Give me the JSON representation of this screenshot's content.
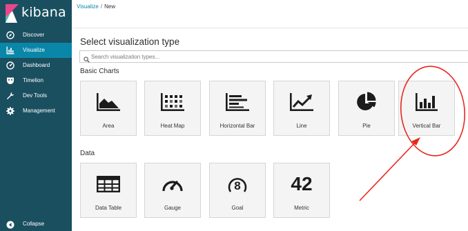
{
  "brand": {
    "name": "kibana"
  },
  "sidebar": {
    "items": [
      {
        "label": "Discover",
        "icon": "compass-icon"
      },
      {
        "label": "Visualize",
        "icon": "bar-chart-icon",
        "active": true
      },
      {
        "label": "Dashboard",
        "icon": "dashboard-gauge-icon"
      },
      {
        "label": "Timelion",
        "icon": "timelion-mask-icon"
      },
      {
        "label": "Dev Tools",
        "icon": "wrench-icon"
      },
      {
        "label": "Management",
        "icon": "gear-icon"
      }
    ],
    "collapse_label": "Collapse"
  },
  "breadcrumb": {
    "link": "Visualize",
    "separator": "/",
    "current": "New"
  },
  "page": {
    "title": "Select visualization type"
  },
  "search": {
    "placeholder": "Search visualization types..."
  },
  "sections": [
    {
      "title": "Basic Charts",
      "tiles": [
        {
          "label": "Area",
          "icon": "area-chart-icon"
        },
        {
          "label": "Heat Map",
          "icon": "heat-map-icon"
        },
        {
          "label": "Horizontal Bar",
          "icon": "horizontal-bar-icon"
        },
        {
          "label": "Line",
          "icon": "line-chart-icon"
        },
        {
          "label": "Pie",
          "icon": "pie-chart-icon"
        },
        {
          "label": "Vertical Bar",
          "icon": "vertical-bar-icon"
        }
      ]
    },
    {
      "title": "Data",
      "tiles": [
        {
          "label": "Data Table",
          "icon": "table-icon"
        },
        {
          "label": "Gauge",
          "icon": "gauge-icon"
        },
        {
          "label": "Goal",
          "icon": "goal-icon",
          "value": "8"
        },
        {
          "label": "Metric",
          "icon": "metric-icon",
          "value": "42"
        }
      ]
    }
  ],
  "colors": {
    "sidebar_bg": "#1a4f60",
    "sidebar_active": "#0a86a8",
    "accent": "#0a86a8",
    "tile_bg": "#f4f4f4",
    "annotation_red": "#e8261c"
  }
}
